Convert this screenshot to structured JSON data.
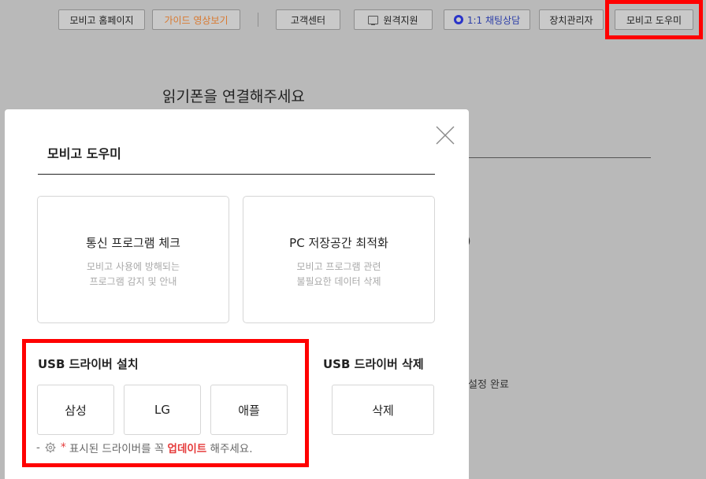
{
  "topbar": {
    "homepage": "모비고 홈페이지",
    "guide_video": "가이드 영상보기",
    "support_center": "고객센터",
    "remote_support": "원격지원",
    "chat": "1:1 채팅상담",
    "device_manager": "장치관리자",
    "helper": "모비고 도우미"
  },
  "background": {
    "heading": "읽기폰을 연결해주세요",
    "paren": ")",
    "complete": "설정 완료"
  },
  "modal": {
    "title": "모비고 도우미",
    "cards": [
      {
        "title": "통신 프로그램 체크",
        "desc1": "모비고 사용에 방해되는",
        "desc2": "프로그램 감지 및 안내"
      },
      {
        "title": "PC 저장공간 최적화",
        "desc1": "모비고 프로그램 관련",
        "desc2": "불필요한 데이터 삭제"
      }
    ],
    "usb_install": {
      "title": "USB 드라이버 설치",
      "buttons": [
        "삼성",
        "LG",
        "애플"
      ]
    },
    "usb_delete": {
      "title": "USB 드라이버 삭제",
      "button": "삭제"
    },
    "note": {
      "prefix": "-",
      "dot": "*",
      "text1": "표시된 드라이버를 꼭",
      "highlight": "업데이트",
      "text2": "해주세요."
    }
  },
  "colors": {
    "accent_orange": "#d9792f",
    "chat_blue": "#2a34c9",
    "highlight_red": "#ff0000",
    "note_red": "#e53b3b"
  }
}
